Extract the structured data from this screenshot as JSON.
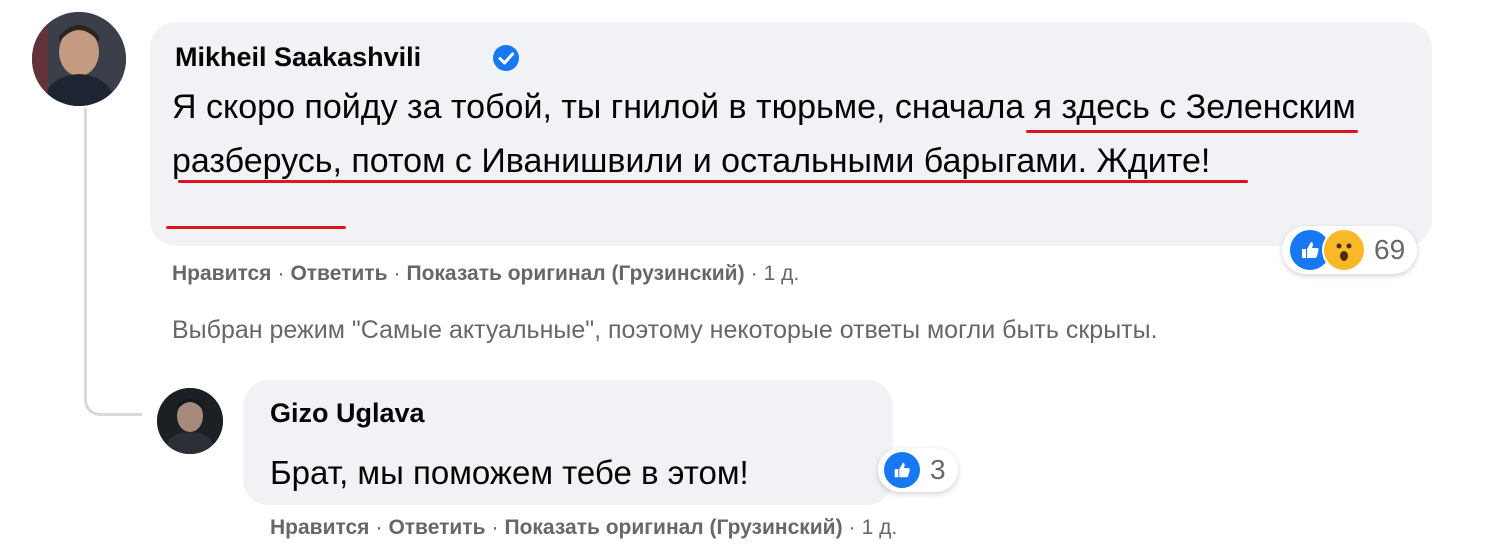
{
  "comment": {
    "author": "Mikheil Saakashvili",
    "text": "Я скоро пойду за тобой, ты гнилой в тюрьме, сначала я здесь с Зеленским разберусь, потом с Иванишвили и остальными барыгами. Ждите!",
    "reaction_count": "69",
    "reactions": [
      "like-icon",
      "wow-icon"
    ],
    "actions": {
      "like": "Нравится",
      "reply": "Ответить",
      "show_original": "Показать оригинал (Грузинский)",
      "time": "1 д."
    }
  },
  "notice": "Выбран режим \"Самые актуальные\", поэтому некоторые ответы могли быть скрыты.",
  "reply": {
    "author": "Gizo Uglava",
    "text": "Брат, мы поможем тебе в этом!",
    "reaction_count": "3",
    "reactions": [
      "like-icon"
    ],
    "actions": {
      "like": "Нравится",
      "reply": "Ответить",
      "show_original": "Показать оригинал (Грузинский)",
      "time": "1 д."
    }
  },
  "colors": {
    "bubble": "#f0f2f5",
    "underline": "#e0141e",
    "meta_text": "#65676b",
    "facebook_blue": "#1877f2"
  }
}
